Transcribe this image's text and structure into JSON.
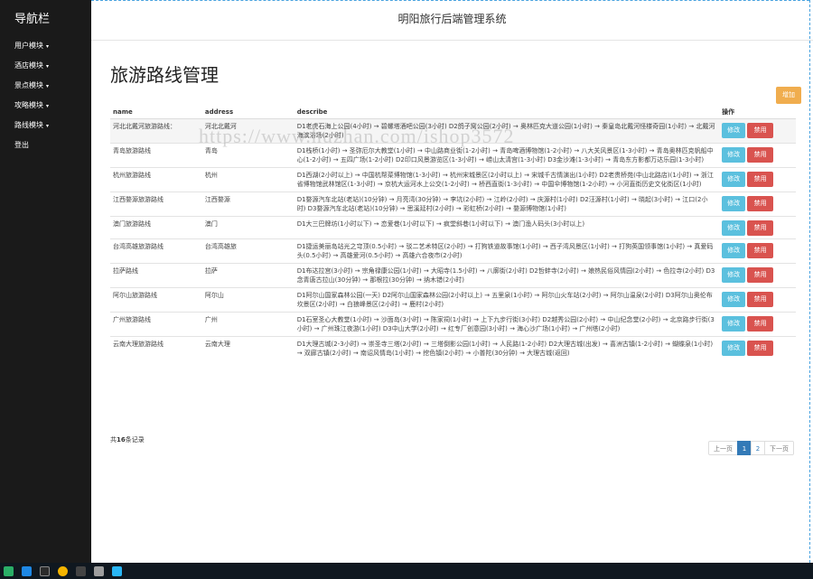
{
  "sidebar": {
    "brand": "导航栏",
    "items": [
      {
        "label": "用户模块",
        "caret": "▾"
      },
      {
        "label": "酒店模块",
        "caret": "▾"
      },
      {
        "label": "景点模块",
        "caret": "▾"
      },
      {
        "label": "攻略模块",
        "caret": "▾"
      },
      {
        "label": "路线模块",
        "caret": "▾"
      },
      {
        "label": "登出",
        "caret": ""
      }
    ]
  },
  "header": {
    "title": "明阳旅行后端管理系统"
  },
  "main": {
    "title": "旅游路线管理",
    "add_label": "增加",
    "columns": {
      "name": "name",
      "address": "address",
      "describe": "describe",
      "op": "操作"
    },
    "edit_label": "修改",
    "delete_label": "禁用",
    "rows": [
      {
        "name": "河北北戴河旅游路线：",
        "address": "河北北戴河",
        "describe": "D1老虎石海上公园(4小时) → 碧螺塔酒吧公园(3小时) D2鸽子窝公园(2小时) → 奥林匹克大道公园(1小时) → 秦皇岛北戴河怪楼奇园(1小时) → 北戴河海滨浴场(2小时)"
      },
      {
        "name": "青岛旅游路线",
        "address": "青岛",
        "describe": "D1栈桥(1小时) → 圣弥厄尔大教堂(1小时) → 中山路商业街(1-2小时) → 青岛啤酒博物馆(1-2小时) → 八大关风景区(1-3小时) → 青岛奥林匹克帆船中心(1-2小时) → 五四广场(1-2小时) D2印口风景游览区(1-3小时) → 崂山太清宫(1-3小时) D3金沙滩(1-3小时) → 青岛东方影都万达乐园(1-3小时)"
      },
      {
        "name": "杭州旅游路线",
        "address": "杭州",
        "describe": "D1西湖(2小时以上) → 中国杭帮菜博物馆(1-3小时) → 杭州宋城景区(2小时以上) → 宋城千古情演出(1小时) D2老贵桥苑(中山北路店)(1小时) → 浙江省博物馆武林馆区(1-3小时) → 京杭大运河水上公交(1-2小时) → 桥西直街(1-3小时) → 中国伞博物馆(1-2小时) → 小河直街历史文化街区(1小时)"
      },
      {
        "name": "江西婺源旅游路线",
        "address": "江西婺源",
        "describe": "D1婺源汽车北站(老站)(10分钟) → 月亮湾(30分钟) → 李坑(2小时) → 江岭(2小时) → 庆源村(1小时) D2汪源村(1小时) → 晓起(3小时) → 江口(2小时) D3婺源汽车北站(老站)(10分钟) → 思溪延村(2小时) → 彩虹桥(2小时) → 婺源博物馆(1小时)"
      },
      {
        "name": "澳门旅游路线",
        "address": "澳门",
        "describe": "D1大三巴牌坊(1小时以下) → 恋爱巷(1小时以下) → 疯堂斜巷(1小时以下) → 澳门渔人码头(3小时以上)"
      },
      {
        "name": "台湾高雄旅游路线",
        "address": "台湾高雄旅",
        "describe": "D1捷运美丽岛站光之穹顶(0.5小时) → 驳二艺术特区(2小时) → 打狗铁道故事馆(1小时) → 西子湾风景区(1小时) → 打狗英国领事馆(1小时) → 真爱码头(0.5小时) → 高雄爱河(0.5小时) → 高雄六合夜市(2小时)"
      },
      {
        "name": "拉萨路线",
        "address": "拉萨",
        "describe": "D1布达拉宫(3小时) → 宗角禄康公园(1小时) → 大昭寺(1.5小时) → 八廓街(2小时) D2哲蚌寺(2小时) → 娘热民俗风情园(2小时) → 色拉寺(2小时) D3念青唐古拉山(30分钟) → 那根拉(30分钟) → 纳木错(2小时)"
      },
      {
        "name": "阿尔山旅游路线",
        "address": "阿尔山",
        "describe": "D1阿尔山国家森林公园(一天) D2阿尔山国家森林公园(2小时以上) → 五里泉(1小时) → 阿尔山火车站(2小时) → 阿尔山温泉(2小时) D3阿尔山奥伦布坎景区(2小时) → 白狼峰景区(2小时) → 鹿村(2小时)"
      },
      {
        "name": "广州旅游路线",
        "address": "广州",
        "describe": "D1石室圣心大教堂(1小时) → 沙面岛(3小时) → 陈家祠(1小时) → 上下九步行街(3小时) D2越秀公园(2小时) → 中山纪念堂(2小时) → 北京路步行街(3小时) → 广州珠江夜游(1小时) D3中山大学(2小时) → 红专厂创意园(3小时) → 海心沙广场(1小时) → 广州塔(2小时)"
      },
      {
        "name": "云南大理旅游路线",
        "address": "云南大理",
        "describe": "D1大理古城(2-3小时) → 崇圣寺三塔(2小时) → 三塔倒影公园(1小时) → 人民路(1-2小时) D2大理古城(出发) → 喜洲古镇(1-2小时) → 蝴蝶泉(1小时) → 双廊古镇(2小时) → 南诏风情岛(1小时) → 挖色镇(2小时) → 小普陀(30分钟) → 大理古城(返回)"
      }
    ],
    "total_prefix": "共",
    "total_count": "16",
    "total_suffix": "条记录",
    "pager": {
      "prev": "上一页",
      "pages": [
        "1",
        "2"
      ],
      "next": "下一页"
    }
  },
  "watermark": "https://www.huzhan.com/ishop3572",
  "colors": {
    "sidebar": "#1a1a1a",
    "add": "#f0ad4e",
    "edit": "#5bc0de",
    "delete": "#d9534f",
    "active_page": "#337ab7"
  }
}
